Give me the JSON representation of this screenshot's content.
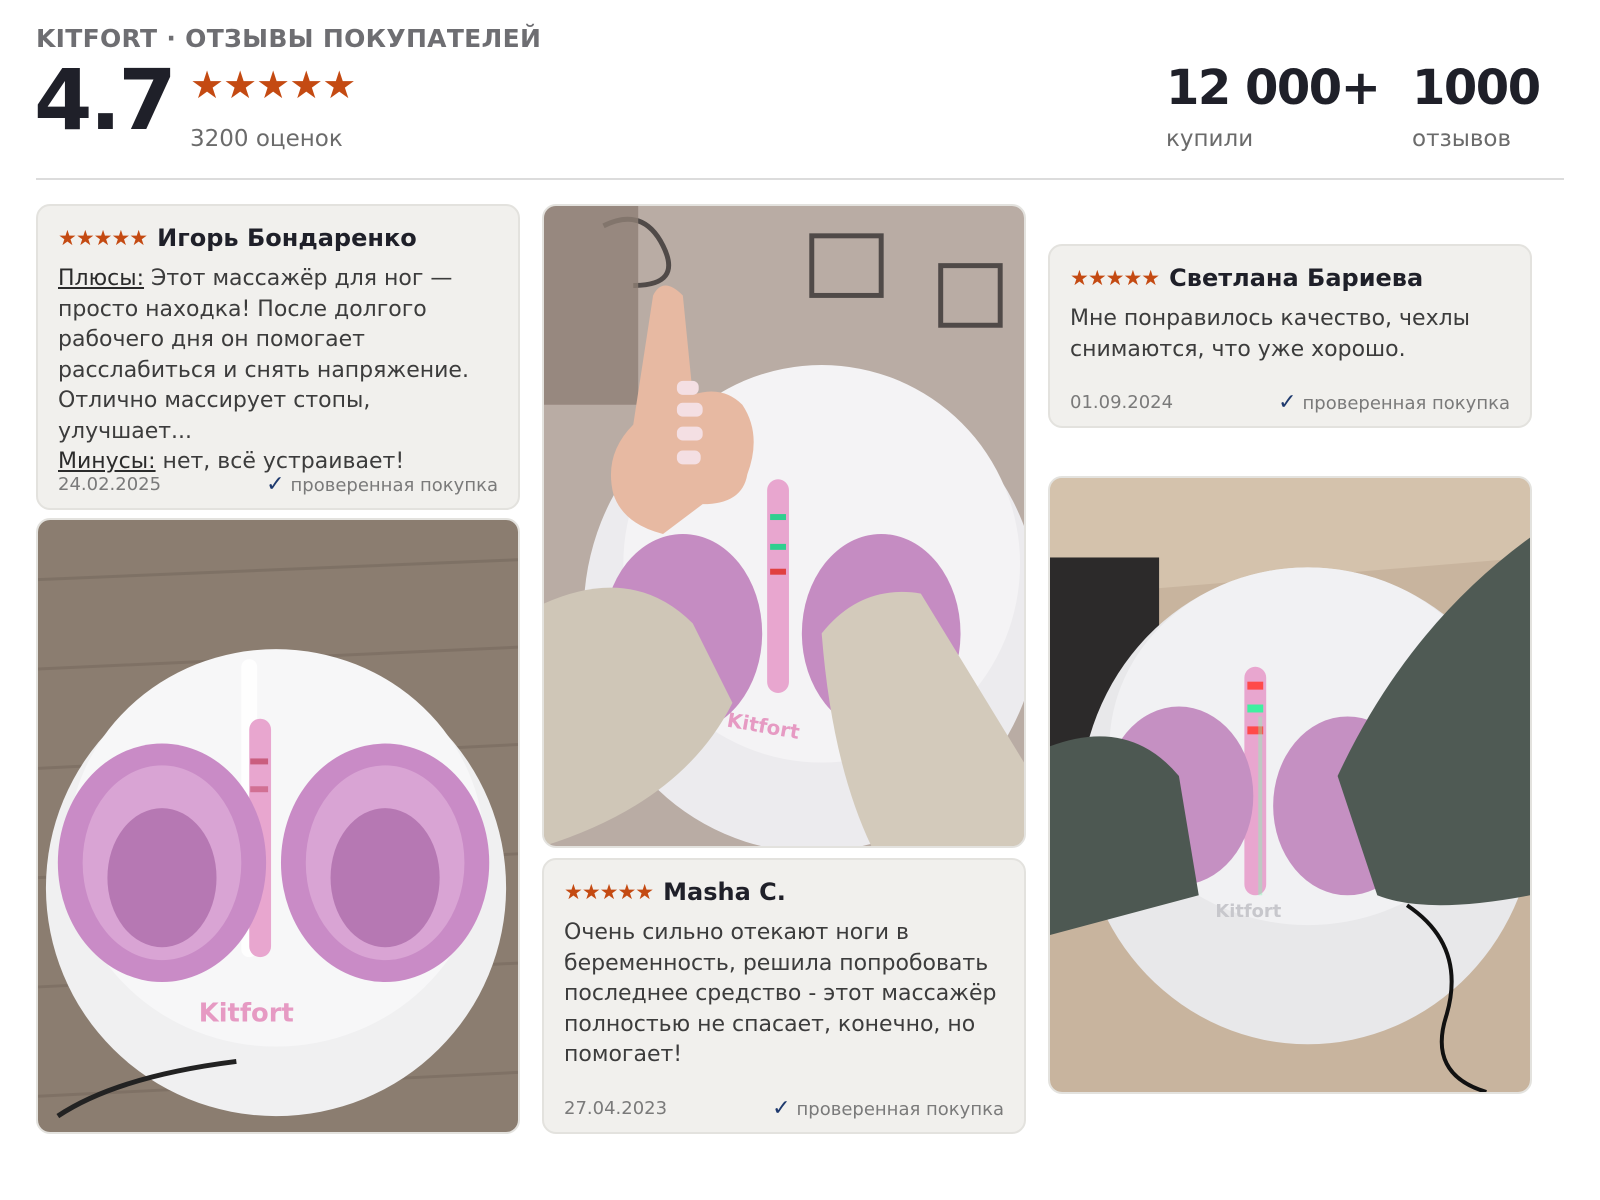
{
  "header": {
    "brand_title": "KITFORT · ОТЗЫВЫ ПОКУПАТЕЛЕЙ",
    "rating": "4.7",
    "stars": "★★★★★",
    "ratings_count": "3200 оценок",
    "stats": [
      {
        "value": "12 000+",
        "label": "купили"
      },
      {
        "value": "1000",
        "label": "отзывов"
      }
    ]
  },
  "reviews": [
    {
      "stars": "★★★★★",
      "author": "Игорь Бондаренко",
      "pros_label": "Плюсы:",
      "pros_text": " Этот массажёр для ног — просто находка! После долгого рабочего дня он помогает расслабиться и снять напряжение. Отлично массирует стопы, улучшает...",
      "cons_label": "Минусы:",
      "cons_text": " нет, всё устраивает!",
      "date": "24.02.2025",
      "verified": "проверенная покупка"
    },
    {
      "stars": "★★★★★",
      "author": "Masha C.",
      "text": "Очень сильно отекают ноги в беременность, решила попробовать последнее средство - этот массажёр полностью не спасает, конечно, но помогает!",
      "date": "27.04.2023",
      "verified": "проверенная покупка"
    },
    {
      "stars": "★★★★★",
      "author": "Светлана Бариева",
      "text": "Мне понравилось качество, чехлы снимаются, что уже хорошо.",
      "date": "01.09.2024",
      "verified": "проверенная покупка"
    }
  ],
  "photos": {
    "logo_text": "Kitfort",
    "colors": {
      "pink": "#e7a3d6",
      "white_body": "#f2f2f3",
      "star": "#c44a12"
    }
  }
}
